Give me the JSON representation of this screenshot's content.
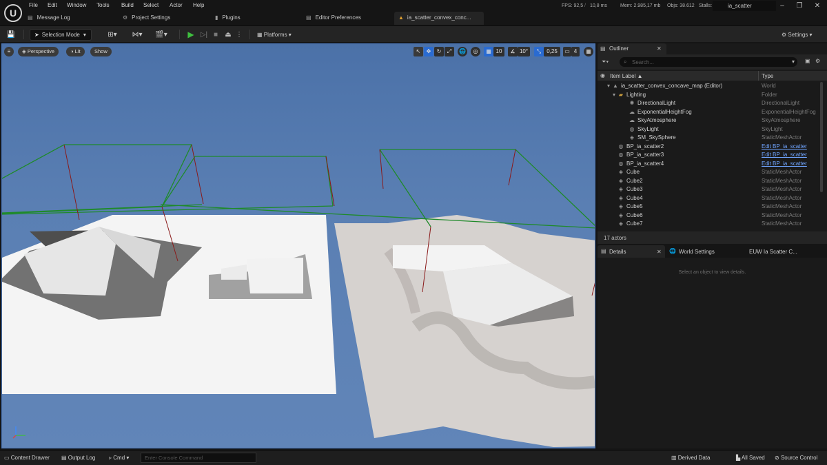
{
  "menu": {
    "items": [
      "File",
      "Edit",
      "Window",
      "Tools",
      "Build",
      "Select",
      "Actor",
      "Help"
    ]
  },
  "stats": {
    "fps": "FPS: 92,5",
    "frame_time": "10,8 ms",
    "mem": "Mem: 2.985,17 mb",
    "objs": "Objs: 38.612",
    "stalls": "Stalls: 3"
  },
  "project": {
    "name": "ia_scatter"
  },
  "tabs": [
    "Message Log",
    "Project Settings",
    "Plugins",
    "Editor Preferences",
    "ia_scatter_convex_conc..."
  ],
  "toolbar": {
    "selection_mode": "Selection Mode",
    "platforms": "Platforms",
    "settings": "Settings"
  },
  "viewport": {
    "perspective": "Perspective",
    "lit": "Lit",
    "show": "Show",
    "grid_snap": "10",
    "rotation_snap": "10°",
    "scale_snap": "0,25",
    "camera_speed": "4"
  },
  "outliner": {
    "title": "Outliner",
    "search_placeholder": "Search...",
    "col_label": "Item Label ▲",
    "col_type": "Type",
    "rows": [
      {
        "label": "ia_scatter_convex_concave_map (Editor)",
        "type": "World",
        "icon": "world-icon"
      },
      {
        "label": "Lighting",
        "type": "Folder",
        "icon": "folder-icon"
      },
      {
        "label": "DirectionalLight",
        "type": "DirectionalLight",
        "icon": "light-icon"
      },
      {
        "label": "ExponentialHeightFog",
        "type": "ExponentialHeightFog",
        "icon": "fog-icon"
      },
      {
        "label": "SkyAtmosphere",
        "type": "SkyAtmosphere",
        "icon": "sky-icon"
      },
      {
        "label": "SkyLight",
        "type": "SkyLight",
        "icon": "skylight-icon"
      },
      {
        "label": "SM_SkySphere",
        "type": "StaticMeshActor",
        "icon": "mesh-icon"
      },
      {
        "label": "BP_ia_scatter2",
        "type": "Edit BP_ia_scatter",
        "icon": "actor-icon"
      },
      {
        "label": "BP_ia_scatter3",
        "type": "Edit BP_ia_scatter",
        "icon": "actor-icon"
      },
      {
        "label": "BP_ia_scatter4",
        "type": "Edit BP_ia_scatter",
        "icon": "actor-icon"
      },
      {
        "label": "Cube",
        "type": "StaticMeshActor",
        "icon": "mesh-icon"
      },
      {
        "label": "Cube2",
        "type": "StaticMeshActor",
        "icon": "mesh-icon"
      },
      {
        "label": "Cube3",
        "type": "StaticMeshActor",
        "icon": "mesh-icon"
      },
      {
        "label": "Cube4",
        "type": "StaticMeshActor",
        "icon": "mesh-icon"
      },
      {
        "label": "Cube5",
        "type": "StaticMeshActor",
        "icon": "mesh-icon"
      },
      {
        "label": "Cube6",
        "type": "StaticMeshActor",
        "icon": "mesh-icon"
      },
      {
        "label": "Cube7",
        "type": "StaticMeshActor",
        "icon": "mesh-icon"
      }
    ],
    "count": "17 actors"
  },
  "details": {
    "tab_details": "Details",
    "tab_world_settings": "World Settings",
    "tab_euw": "EUW Ia Scatter C...",
    "empty_message": "Select an object to view details."
  },
  "statusbar": {
    "content_drawer": "Content Drawer",
    "output_log": "Output Log",
    "cmd": "Cmd",
    "console_placeholder": "Enter Console Command",
    "derived_data": "Derived Data",
    "all_saved": "All Saved",
    "source_control": "Source Control"
  },
  "colors": {
    "viewport_sky": "#5a7fb3",
    "link": "#6fa4ff",
    "play_green": "#3fbf3f",
    "bounds_green": "#1f8a2a",
    "bounds_red": "#8a1a1a"
  }
}
